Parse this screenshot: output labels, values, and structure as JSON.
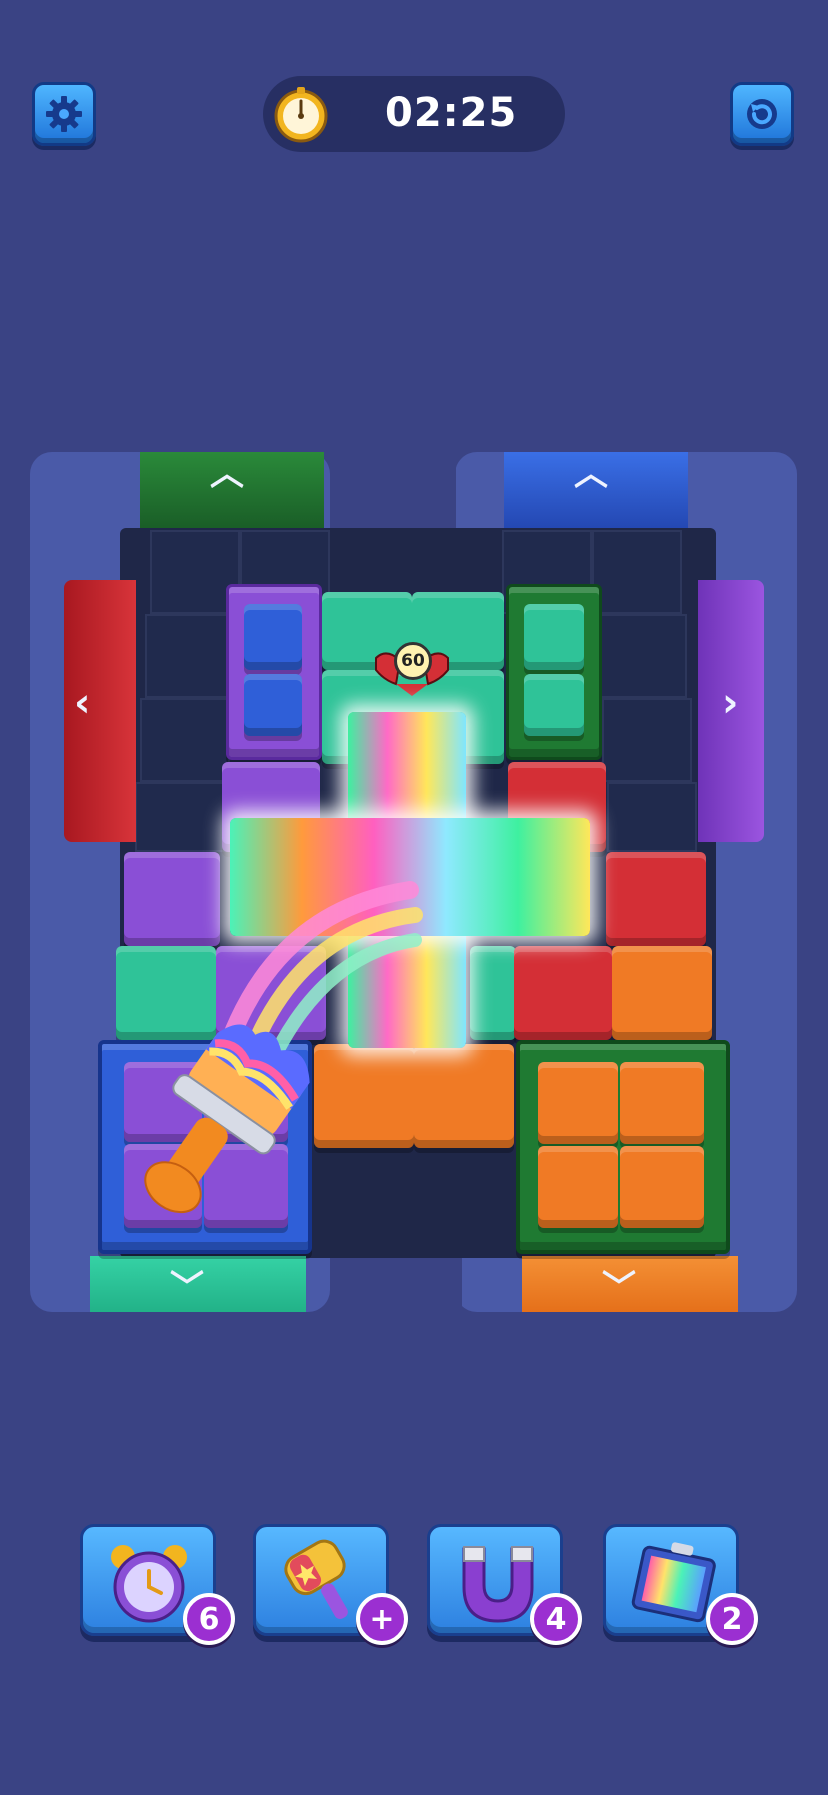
{
  "hud": {
    "timer": "02:25",
    "settings_icon": "gear-icon",
    "restart_icon": "restart-icon",
    "timer_icon": "stopwatch-icon"
  },
  "board": {
    "target_counter": "60",
    "exits": [
      {
        "name": "exit-green-top",
        "color": "#1f7a32",
        "direction": "up"
      },
      {
        "name": "exit-blue-top",
        "color": "#2f5fd8",
        "direction": "up"
      },
      {
        "name": "exit-red-left",
        "color": "#c8232a",
        "direction": "left"
      },
      {
        "name": "exit-purple-right",
        "color": "#8a45d1",
        "direction": "right"
      },
      {
        "name": "exit-teal-bottom",
        "color": "#28c59a",
        "direction": "down"
      },
      {
        "name": "exit-orange-bottom",
        "color": "#f08228",
        "direction": "down"
      }
    ],
    "colors": {
      "purple": "#8a4fd6",
      "teal": "#2fc398",
      "green": "#1f7a32",
      "red": "#d42f36",
      "orange": "#f07a25",
      "blue": "#2f5fd8",
      "rainbow": "rainbow"
    }
  },
  "boosters": [
    {
      "name": "alarm-clock-booster",
      "icon": "alarm-clock-icon",
      "count": "6"
    },
    {
      "name": "hammer-booster",
      "icon": "hammer-icon",
      "count": "+"
    },
    {
      "name": "magnet-booster",
      "icon": "magnet-icon",
      "count": "4"
    },
    {
      "name": "paint-bucket-booster",
      "icon": "rainbow-bucket-icon",
      "count": "2"
    }
  ]
}
